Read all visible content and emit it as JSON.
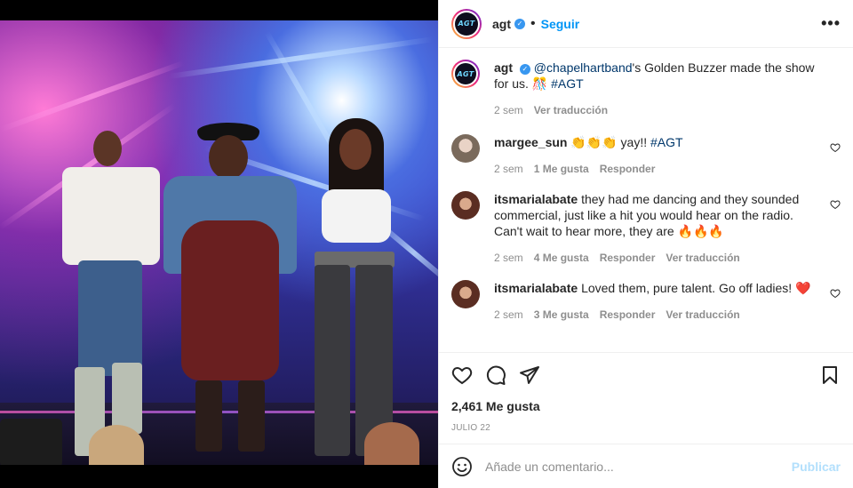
{
  "post": {
    "author": "agt",
    "author_logo_text": "AGT",
    "follow_label": "Seguir",
    "more_label": "•••",
    "caption": {
      "username": "agt",
      "mention": "@chapelhartband",
      "text": "'s Golden Buzzer made the show for us.",
      "emoji": "🎊",
      "hashtag": "#AGT",
      "time": "2 sem",
      "translate": "Ver traducción"
    },
    "likes": "2,461 Me gusta",
    "date": "JULIO 22"
  },
  "comments": [
    {
      "username": "margee_sun",
      "text": "👏👏👏 yay!! ",
      "hashtag": "#AGT",
      "time": "2 sem",
      "likes": "1 Me gusta",
      "reply": "Responder",
      "translate": ""
    },
    {
      "username": "itsmarialabate",
      "text": "they had me dancing and they sounded commercial, just like a hit you would hear on the radio. Can't wait to hear more, they are 🔥🔥🔥",
      "time": "2 sem",
      "likes": "4 Me gusta",
      "reply": "Responder",
      "translate": "Ver traducción"
    },
    {
      "username": "itsmarialabate",
      "text": "Loved them, pure talent. Go off ladies! ❤️",
      "time": "2 sem",
      "likes": "3 Me gusta",
      "reply": "Responder",
      "translate": "Ver traducción"
    }
  ],
  "add_comment": {
    "placeholder": "Añade un comentario...",
    "publish_label": "Publicar"
  },
  "icons": {
    "like": "heart-icon",
    "comment": "comment-icon",
    "share": "share-icon",
    "save": "bookmark-icon",
    "emoji": "emoji-icon"
  },
  "colors": {
    "link": "#0095f6",
    "verified": "#3897f0",
    "hashtag": "#00376b",
    "muted": "#8e8e8e",
    "publish_disabled": "#b2dffc"
  }
}
